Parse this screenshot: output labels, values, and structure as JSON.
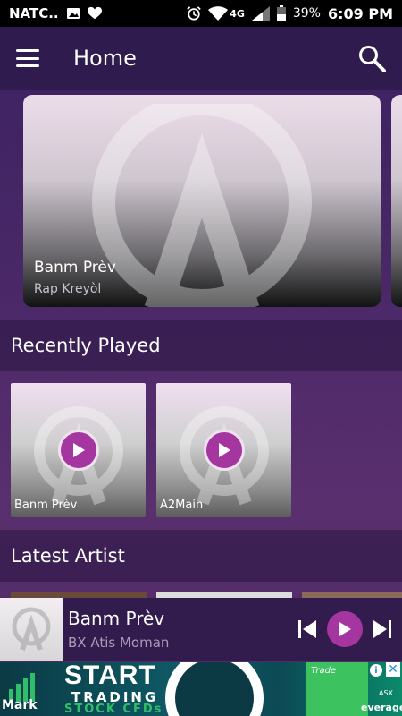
{
  "status": {
    "carrier": "NATC..",
    "network": "4G",
    "battery": "39%",
    "time": "6:09 PM"
  },
  "appbar": {
    "title": "Home",
    "menu_icon": "hamburger-icon",
    "search_icon": "search-icon"
  },
  "featured": {
    "title": "Banm Prèv",
    "subtitle": "Rap Kreyòl"
  },
  "recently_played": {
    "header": "Recently Played",
    "items": [
      {
        "label": "Banm Prèv"
      },
      {
        "label": "A2Main"
      }
    ]
  },
  "latest_artist": {
    "header": "Latest Artist"
  },
  "player": {
    "title": "Banm Prèv",
    "artist": "BX Atis Moman"
  },
  "ad": {
    "headline": "START",
    "line2": "TRADING",
    "line3": "STOCK CFDs",
    "brand": "Mark",
    "right_tag": "Trade",
    "right_tag2": "everage",
    "exchange": "ASX"
  },
  "colors": {
    "accent": "#a536a0",
    "appbar": "#2f1b4e",
    "player": "#321c4d"
  }
}
